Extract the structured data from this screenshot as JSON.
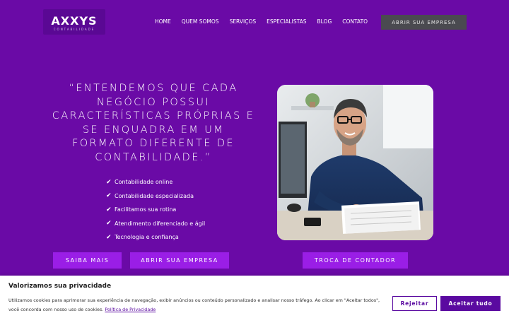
{
  "logo": {
    "name": "AXXYS",
    "tagline": "CONTABILIDADE"
  },
  "nav": {
    "items": [
      "HOME",
      "QUEM SOMOS",
      "SERVIÇOS",
      "ESPECIALISTAS",
      "BLOG",
      "CONTATO"
    ]
  },
  "header": {
    "cta_label": "ABRIR SUA EMPRESA"
  },
  "hero": {
    "quote": "“ENTENDEMOS QUE CADA NEGÓCIO POSSUI CARACTERÍSTICAS PRÓPRIAS E SE ENQUADRA EM UM FORMATO DIFERENTE DE CONTABILIDADE.”",
    "features": [
      "Contabilidade online",
      "Contabilidade especializada",
      "Facilitamos sua rotina",
      "Atendimento diferenciado e ágil",
      "Tecnologia e confiança"
    ],
    "buttons": {
      "learn_more": "SAIBA MAIS",
      "open_company": "ABRIR SUA EMPRESA",
      "switch_accountant": "TROCA DE CONTADOR"
    }
  },
  "cookie": {
    "title": "Valorizamos sua privacidade",
    "text": "Utilizamos cookies para aprimorar sua experiência de navegação, exibir anúncios ou conteúdo personalizado e analisar nosso tráfego. Ao clicar em \"Aceitar todos\", você concorda com nosso uso de cookies.",
    "policy_link": "Política de Privacidade",
    "reject_label": "Rejeitar",
    "accept_label": "Aceitar tudo"
  },
  "colors": {
    "background": "#6a0aa6",
    "accent": "#9a1ee6",
    "header_button": "#4a4a50",
    "cookie_primary": "#5a0aa0"
  },
  "icons": {
    "feature_bullet": "check-icon"
  }
}
